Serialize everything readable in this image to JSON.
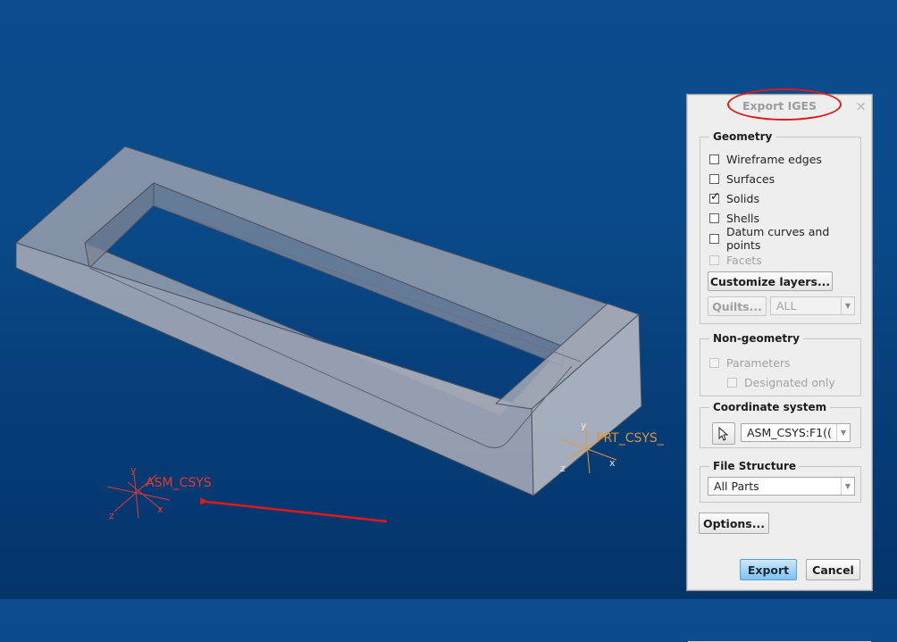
{
  "viewport": {
    "asm_csys_label": "ASM_CSYS",
    "prt_csys_label": "PRT_CSYS_",
    "axis_x": "x",
    "axis_y": "y",
    "axis_z": "z"
  },
  "dialog": {
    "title": "Export IGES",
    "close_glyph": "×",
    "geometry": {
      "legend": "Geometry",
      "options": [
        {
          "label": "Wireframe edges",
          "checked": false,
          "enabled": true
        },
        {
          "label": "Surfaces",
          "checked": false,
          "enabled": true
        },
        {
          "label": "Solids",
          "checked": true,
          "enabled": true
        },
        {
          "label": "Shells",
          "checked": false,
          "enabled": true
        },
        {
          "label": "Datum curves and points",
          "checked": false,
          "enabled": true
        },
        {
          "label": "Facets",
          "checked": false,
          "enabled": false
        }
      ],
      "customize_layers_label": "Customize layers...",
      "quilts_label": "Quilts...",
      "quilts_value": "ALL"
    },
    "non_geometry": {
      "legend": "Non-geometry",
      "parameters_label": "Parameters",
      "designated_only_label": "Designated only"
    },
    "coordinate_system": {
      "legend": "Coordinate system",
      "value": "ASM_CSYS:F1(("
    },
    "file_structure": {
      "legend": "File Structure",
      "value": "All Parts"
    },
    "options_label": "Options...",
    "export_label": "Export",
    "cancel_label": "Cancel"
  },
  "colors": {
    "background_top": "#0b4d8f",
    "background_bottom": "#04346a",
    "part_fill": "#a7acb9",
    "csys_asm": "#e8392d",
    "csys_prt": "#e39a38",
    "annotation_red": "#e01818",
    "export_button": "#7fc0f0"
  },
  "icons": {
    "coordinate_select": "cursor-arrow-icon",
    "dropdown": "chevron-down-icon",
    "close": "close-icon"
  }
}
